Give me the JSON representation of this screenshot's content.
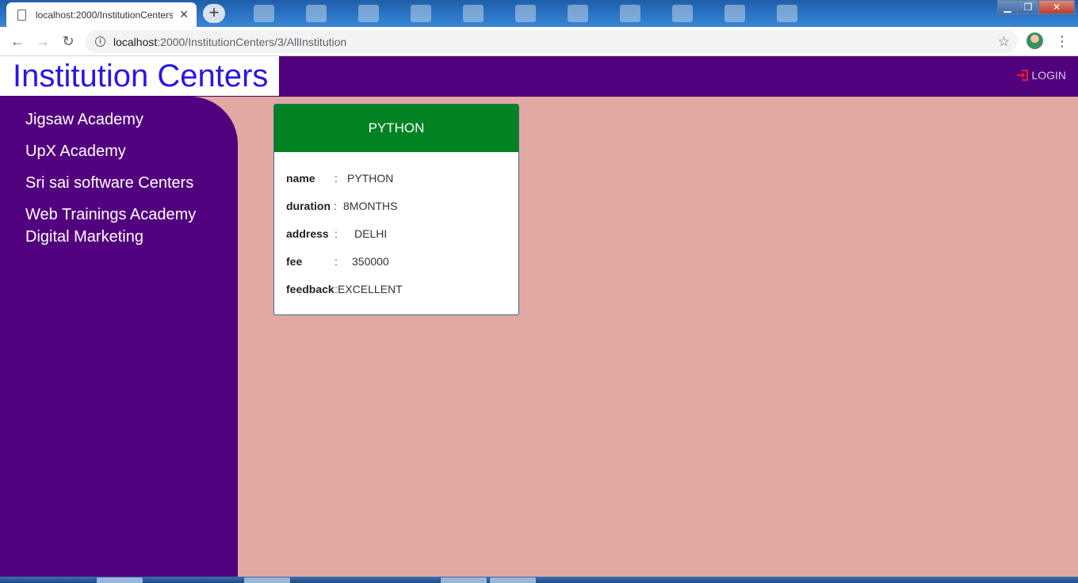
{
  "browser": {
    "tab_title": "localhost:2000/InstitutionCenters",
    "tab_close": "✕",
    "new_tab": "+",
    "url_host": "localhost",
    "url_rest": ":2000/InstitutionCenters/3/AllInstitution",
    "window_buttons": {
      "minimize": "▁",
      "maximize": "❐",
      "close": "✕"
    }
  },
  "header": {
    "title": "Institution Centers",
    "login_label": "LOGIN",
    "login_icon_color": "#e0202a"
  },
  "sidebar": {
    "items": [
      {
        "label": "Jigsaw Academy"
      },
      {
        "label": "UpX Academy"
      },
      {
        "label": "Sri sai software Centers"
      },
      {
        "label": "Web Trainings Academy"
      },
      {
        "label": "Digital Marketing"
      }
    ]
  },
  "card": {
    "title": "PYTHON",
    "header_color": "#028223",
    "fields": [
      {
        "label": "name",
        "sep": ":",
        "value": "PYTHON"
      },
      {
        "label": "duration",
        "sep": ":",
        "value": "8MONTHS"
      },
      {
        "label": "address",
        "sep": ":",
        "value": "DELHI"
      },
      {
        "label": "fee",
        "sep": ":",
        "value": "350000"
      },
      {
        "label": "feedback",
        "sep": ":",
        "value": "EXCELLENT"
      }
    ]
  },
  "colors": {
    "page_bg": "#e2a8a2",
    "purple": "#52017e",
    "brand_text": "#2916e6"
  }
}
